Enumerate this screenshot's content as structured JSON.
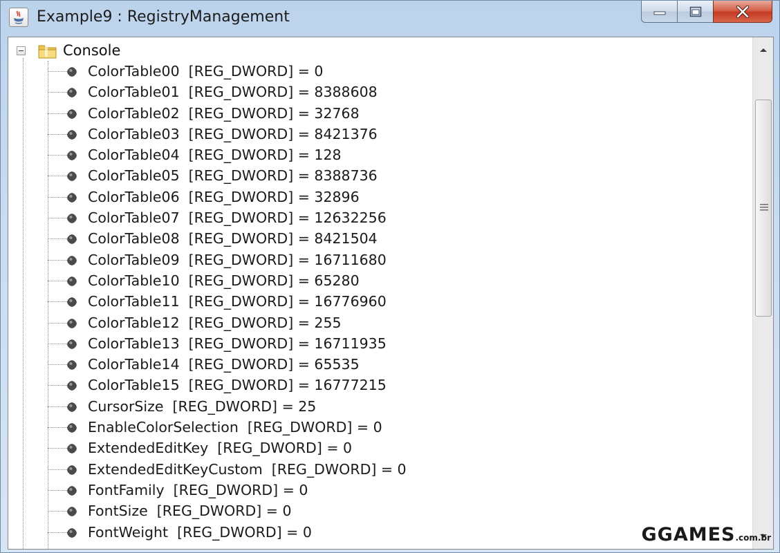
{
  "window": {
    "title": "Example9 : RegistryManagement"
  },
  "tree": {
    "root": {
      "label": "Console",
      "icon": "folder-icon"
    },
    "items": [
      {
        "label": "ColorTable00  [REG_DWORD] = 0"
      },
      {
        "label": "ColorTable01  [REG_DWORD] = 8388608"
      },
      {
        "label": "ColorTable02  [REG_DWORD] = 32768"
      },
      {
        "label": "ColorTable03  [REG_DWORD] = 8421376"
      },
      {
        "label": "ColorTable04  [REG_DWORD] = 128"
      },
      {
        "label": "ColorTable05  [REG_DWORD] = 8388736"
      },
      {
        "label": "ColorTable06  [REG_DWORD] = 32896"
      },
      {
        "label": "ColorTable07  [REG_DWORD] = 12632256"
      },
      {
        "label": "ColorTable08  [REG_DWORD] = 8421504"
      },
      {
        "label": "ColorTable09  [REG_DWORD] = 16711680"
      },
      {
        "label": "ColorTable10  [REG_DWORD] = 65280"
      },
      {
        "label": "ColorTable11  [REG_DWORD] = 16776960"
      },
      {
        "label": "ColorTable12  [REG_DWORD] = 255"
      },
      {
        "label": "ColorTable13  [REG_DWORD] = 16711935"
      },
      {
        "label": "ColorTable14  [REG_DWORD] = 65535"
      },
      {
        "label": "ColorTable15  [REG_DWORD] = 16777215"
      },
      {
        "label": "CursorSize  [REG_DWORD] = 25"
      },
      {
        "label": "EnableColorSelection  [REG_DWORD] = 0"
      },
      {
        "label": "ExtendedEditKey  [REG_DWORD] = 0"
      },
      {
        "label": "ExtendedEditKeyCustom  [REG_DWORD] = 0"
      },
      {
        "label": "FontFamily  [REG_DWORD] = 0"
      },
      {
        "label": "FontSize  [REG_DWORD] = 0"
      },
      {
        "label": "FontWeight  [REG_DWORD] = 0"
      }
    ]
  },
  "watermark": {
    "brand": "GGAMES",
    "tld": ".com.br"
  }
}
